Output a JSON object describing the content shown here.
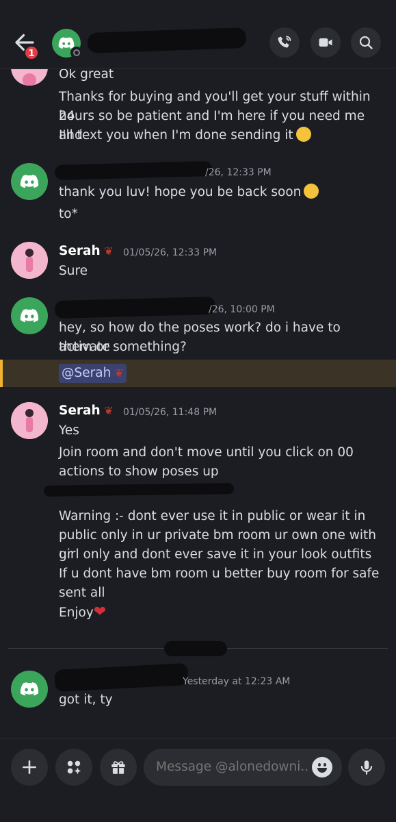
{
  "header": {
    "notification_count": "1",
    "colors": {
      "accent_green": "#3ba55c",
      "badge_red": "#e23d44"
    },
    "icons": [
      "back-arrow-icon",
      "discord-logo-icon",
      "call-icon",
      "video-icon",
      "search-icon"
    ]
  },
  "messages": [
    {
      "lines": [
        "Ok great",
        "Thanks for buying and you'll get your stuff within 24",
        "hours so be patient and I'm here if you need me and",
        "I'll text you when I'm done sending it"
      ]
    },
    {
      "timestamp": "/26, 12:33 PM",
      "lines": [
        "thank you luv! hope you be back soon",
        "to*"
      ]
    },
    {
      "username": "Serah",
      "timestamp": "01/05/26, 12:33 PM",
      "lines": [
        "Sure"
      ]
    },
    {
      "timestamp": "/26, 10:00 PM",
      "lines": [
        "hey, so how do the poses work? do i have to activate",
        "them or something?"
      ],
      "mention": "@Serah"
    },
    {
      "username": "Serah",
      "timestamp": "01/05/26, 11:48 PM",
      "lines": [
        "Yes",
        "Join room and don't move until you click on 00",
        "actions to show poses up",
        "Warning :- dont ever use it in public or wear it in",
        "public only in ur private bm room ur own one with ur",
        "girl only and dont ever save it in your look outfits",
        "If u dont have bm room u better buy room for safe",
        "sent all",
        "Enjoy"
      ]
    },
    {
      "timestamp": "Yesterday at 12:23 AM",
      "lines": [
        "got it, ty"
      ]
    }
  ],
  "composer": {
    "placeholder": "Message @alonedowni..",
    "icons": [
      "plus-icon",
      "apps-icon",
      "gift-icon",
      "emoji-icon",
      "microphone-icon"
    ]
  }
}
